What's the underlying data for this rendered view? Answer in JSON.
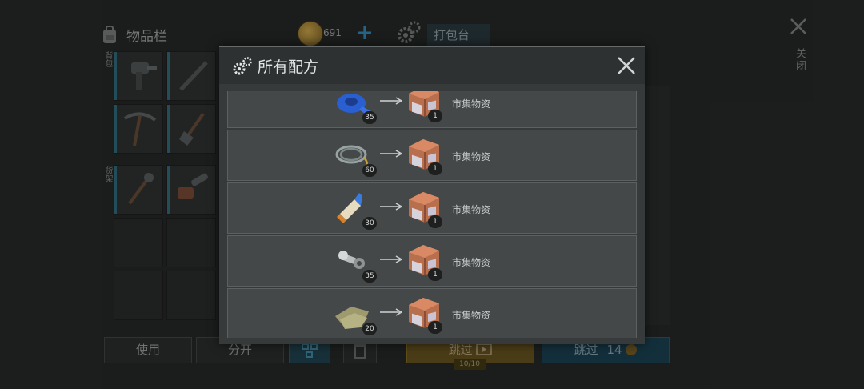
{
  "inventory": {
    "title": "物品栏",
    "coins": "691",
    "pack_bench_label": "打包台",
    "side_label_top": "背包",
    "side_label_mid": "货架"
  },
  "bottom_bar": {
    "use_label": "使用",
    "split_label": "分开",
    "skip_video_label": "跳过",
    "skip_video_count": "10/10",
    "skip_coin_label": "跳过",
    "skip_coin_cost": "14"
  },
  "close_label": "关闭",
  "modal": {
    "title": "所有配方",
    "recipes": [
      {
        "ingredient_icon": "blue-tape-icon",
        "ingredient_qty": "35",
        "result_icon": "supply-crate-icon",
        "result_qty": "1",
        "result_name": "市集物资"
      },
      {
        "ingredient_icon": "wire-coil-icon",
        "ingredient_qty": "60",
        "result_icon": "supply-crate-icon",
        "result_qty": "1",
        "result_name": "市集物资"
      },
      {
        "ingredient_icon": "glue-bottle-icon",
        "ingredient_qty": "30",
        "result_icon": "supply-crate-icon",
        "result_qty": "1",
        "result_name": "市集物资"
      },
      {
        "ingredient_icon": "bolt-nut-icon",
        "ingredient_qty": "35",
        "result_icon": "supply-crate-icon",
        "result_qty": "1",
        "result_name": "市集物资"
      },
      {
        "ingredient_icon": "cloth-scraps-icon",
        "ingredient_qty": "20",
        "result_icon": "supply-crate-icon",
        "result_qty": "1",
        "result_name": "市集物资"
      }
    ]
  },
  "colors": {
    "modal_bg": "#373a3a",
    "row_bg": "#454848",
    "accent_blue": "#2c7aa5",
    "skip_video_bg": "#5b4a1b",
    "skip_coin_bg": "#183a48"
  }
}
